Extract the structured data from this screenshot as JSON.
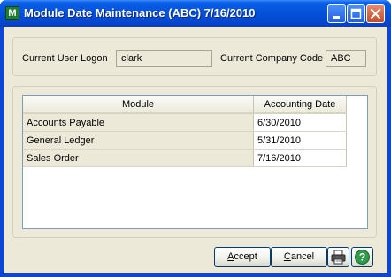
{
  "window": {
    "title": "Module Date Maintenance (ABC) 7/16/2010",
    "app_icon": "sage-mas-icon",
    "controls": [
      "minimize-icon",
      "maximize-icon",
      "close-icon"
    ]
  },
  "header": {
    "user_label": "Current User Logon",
    "user_value": "clark",
    "company_label": "Current Company Code",
    "company_value": "ABC"
  },
  "grid": {
    "columns": [
      "Module",
      "Accounting Date"
    ],
    "rows": [
      {
        "module": "Accounts Payable",
        "date": "6/30/2010"
      },
      {
        "module": "General Ledger",
        "date": "5/31/2010"
      },
      {
        "module": "Sales Order",
        "date": "7/16/2010"
      }
    ]
  },
  "buttons": {
    "accept_hotkey": "A",
    "accept_rest": "ccept",
    "cancel_hotkey": "C",
    "cancel_rest": "ancel",
    "print_icon": "printer-icon",
    "help_icon": "help-icon"
  },
  "colors": {
    "titlebar": "#0552da",
    "client_bg": "#ece9d8",
    "button_border": "#003c74"
  }
}
